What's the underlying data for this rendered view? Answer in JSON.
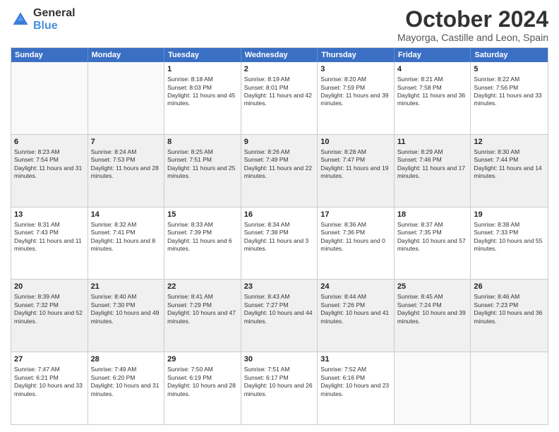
{
  "logo": {
    "line1": "General",
    "line2": "Blue"
  },
  "title": "October 2024",
  "subtitle": "Mayorga, Castille and Leon, Spain",
  "header_days": [
    "Sunday",
    "Monday",
    "Tuesday",
    "Wednesday",
    "Thursday",
    "Friday",
    "Saturday"
  ],
  "weeks": [
    [
      {
        "day": "",
        "sunrise": "",
        "sunset": "",
        "daylight": "",
        "empty": true
      },
      {
        "day": "",
        "sunrise": "",
        "sunset": "",
        "daylight": "",
        "empty": true
      },
      {
        "day": "1",
        "sunrise": "Sunrise: 8:18 AM",
        "sunset": "Sunset: 8:03 PM",
        "daylight": "Daylight: 11 hours and 45 minutes."
      },
      {
        "day": "2",
        "sunrise": "Sunrise: 8:19 AM",
        "sunset": "Sunset: 8:01 PM",
        "daylight": "Daylight: 11 hours and 42 minutes."
      },
      {
        "day": "3",
        "sunrise": "Sunrise: 8:20 AM",
        "sunset": "Sunset: 7:59 PM",
        "daylight": "Daylight: 11 hours and 39 minutes."
      },
      {
        "day": "4",
        "sunrise": "Sunrise: 8:21 AM",
        "sunset": "Sunset: 7:58 PM",
        "daylight": "Daylight: 11 hours and 36 minutes."
      },
      {
        "day": "5",
        "sunrise": "Sunrise: 8:22 AM",
        "sunset": "Sunset: 7:56 PM",
        "daylight": "Daylight: 11 hours and 33 minutes."
      }
    ],
    [
      {
        "day": "6",
        "sunrise": "Sunrise: 8:23 AM",
        "sunset": "Sunset: 7:54 PM",
        "daylight": "Daylight: 11 hours and 31 minutes."
      },
      {
        "day": "7",
        "sunrise": "Sunrise: 8:24 AM",
        "sunset": "Sunset: 7:53 PM",
        "daylight": "Daylight: 11 hours and 28 minutes."
      },
      {
        "day": "8",
        "sunrise": "Sunrise: 8:25 AM",
        "sunset": "Sunset: 7:51 PM",
        "daylight": "Daylight: 11 hours and 25 minutes."
      },
      {
        "day": "9",
        "sunrise": "Sunrise: 8:26 AM",
        "sunset": "Sunset: 7:49 PM",
        "daylight": "Daylight: 11 hours and 22 minutes."
      },
      {
        "day": "10",
        "sunrise": "Sunrise: 8:28 AM",
        "sunset": "Sunset: 7:47 PM",
        "daylight": "Daylight: 11 hours and 19 minutes."
      },
      {
        "day": "11",
        "sunrise": "Sunrise: 8:29 AM",
        "sunset": "Sunset: 7:46 PM",
        "daylight": "Daylight: 11 hours and 17 minutes."
      },
      {
        "day": "12",
        "sunrise": "Sunrise: 8:30 AM",
        "sunset": "Sunset: 7:44 PM",
        "daylight": "Daylight: 11 hours and 14 minutes."
      }
    ],
    [
      {
        "day": "13",
        "sunrise": "Sunrise: 8:31 AM",
        "sunset": "Sunset: 7:43 PM",
        "daylight": "Daylight: 11 hours and 11 minutes."
      },
      {
        "day": "14",
        "sunrise": "Sunrise: 8:32 AM",
        "sunset": "Sunset: 7:41 PM",
        "daylight": "Daylight: 11 hours and 8 minutes."
      },
      {
        "day": "15",
        "sunrise": "Sunrise: 8:33 AM",
        "sunset": "Sunset: 7:39 PM",
        "daylight": "Daylight: 11 hours and 6 minutes."
      },
      {
        "day": "16",
        "sunrise": "Sunrise: 8:34 AM",
        "sunset": "Sunset: 7:38 PM",
        "daylight": "Daylight: 11 hours and 3 minutes."
      },
      {
        "day": "17",
        "sunrise": "Sunrise: 8:36 AM",
        "sunset": "Sunset: 7:36 PM",
        "daylight": "Daylight: 11 hours and 0 minutes."
      },
      {
        "day": "18",
        "sunrise": "Sunrise: 8:37 AM",
        "sunset": "Sunset: 7:35 PM",
        "daylight": "Daylight: 10 hours and 57 minutes."
      },
      {
        "day": "19",
        "sunrise": "Sunrise: 8:38 AM",
        "sunset": "Sunset: 7:33 PM",
        "daylight": "Daylight: 10 hours and 55 minutes."
      }
    ],
    [
      {
        "day": "20",
        "sunrise": "Sunrise: 8:39 AM",
        "sunset": "Sunset: 7:32 PM",
        "daylight": "Daylight: 10 hours and 52 minutes."
      },
      {
        "day": "21",
        "sunrise": "Sunrise: 8:40 AM",
        "sunset": "Sunset: 7:30 PM",
        "daylight": "Daylight: 10 hours and 49 minutes."
      },
      {
        "day": "22",
        "sunrise": "Sunrise: 8:41 AM",
        "sunset": "Sunset: 7:29 PM",
        "daylight": "Daylight: 10 hours and 47 minutes."
      },
      {
        "day": "23",
        "sunrise": "Sunrise: 8:43 AM",
        "sunset": "Sunset: 7:27 PM",
        "daylight": "Daylight: 10 hours and 44 minutes."
      },
      {
        "day": "24",
        "sunrise": "Sunrise: 8:44 AM",
        "sunset": "Sunset: 7:26 PM",
        "daylight": "Daylight: 10 hours and 41 minutes."
      },
      {
        "day": "25",
        "sunrise": "Sunrise: 8:45 AM",
        "sunset": "Sunset: 7:24 PM",
        "daylight": "Daylight: 10 hours and 39 minutes."
      },
      {
        "day": "26",
        "sunrise": "Sunrise: 8:46 AM",
        "sunset": "Sunset: 7:23 PM",
        "daylight": "Daylight: 10 hours and 36 minutes."
      }
    ],
    [
      {
        "day": "27",
        "sunrise": "Sunrise: 7:47 AM",
        "sunset": "Sunset: 6:21 PM",
        "daylight": "Daylight: 10 hours and 33 minutes."
      },
      {
        "day": "28",
        "sunrise": "Sunrise: 7:49 AM",
        "sunset": "Sunset: 6:20 PM",
        "daylight": "Daylight: 10 hours and 31 minutes."
      },
      {
        "day": "29",
        "sunrise": "Sunrise: 7:50 AM",
        "sunset": "Sunset: 6:19 PM",
        "daylight": "Daylight: 10 hours and 28 minutes."
      },
      {
        "day": "30",
        "sunrise": "Sunrise: 7:51 AM",
        "sunset": "Sunset: 6:17 PM",
        "daylight": "Daylight: 10 hours and 26 minutes."
      },
      {
        "day": "31",
        "sunrise": "Sunrise: 7:52 AM",
        "sunset": "Sunset: 6:16 PM",
        "daylight": "Daylight: 10 hours and 23 minutes."
      },
      {
        "day": "",
        "sunrise": "",
        "sunset": "",
        "daylight": "",
        "empty": true
      },
      {
        "day": "",
        "sunrise": "",
        "sunset": "",
        "daylight": "",
        "empty": true
      }
    ]
  ]
}
